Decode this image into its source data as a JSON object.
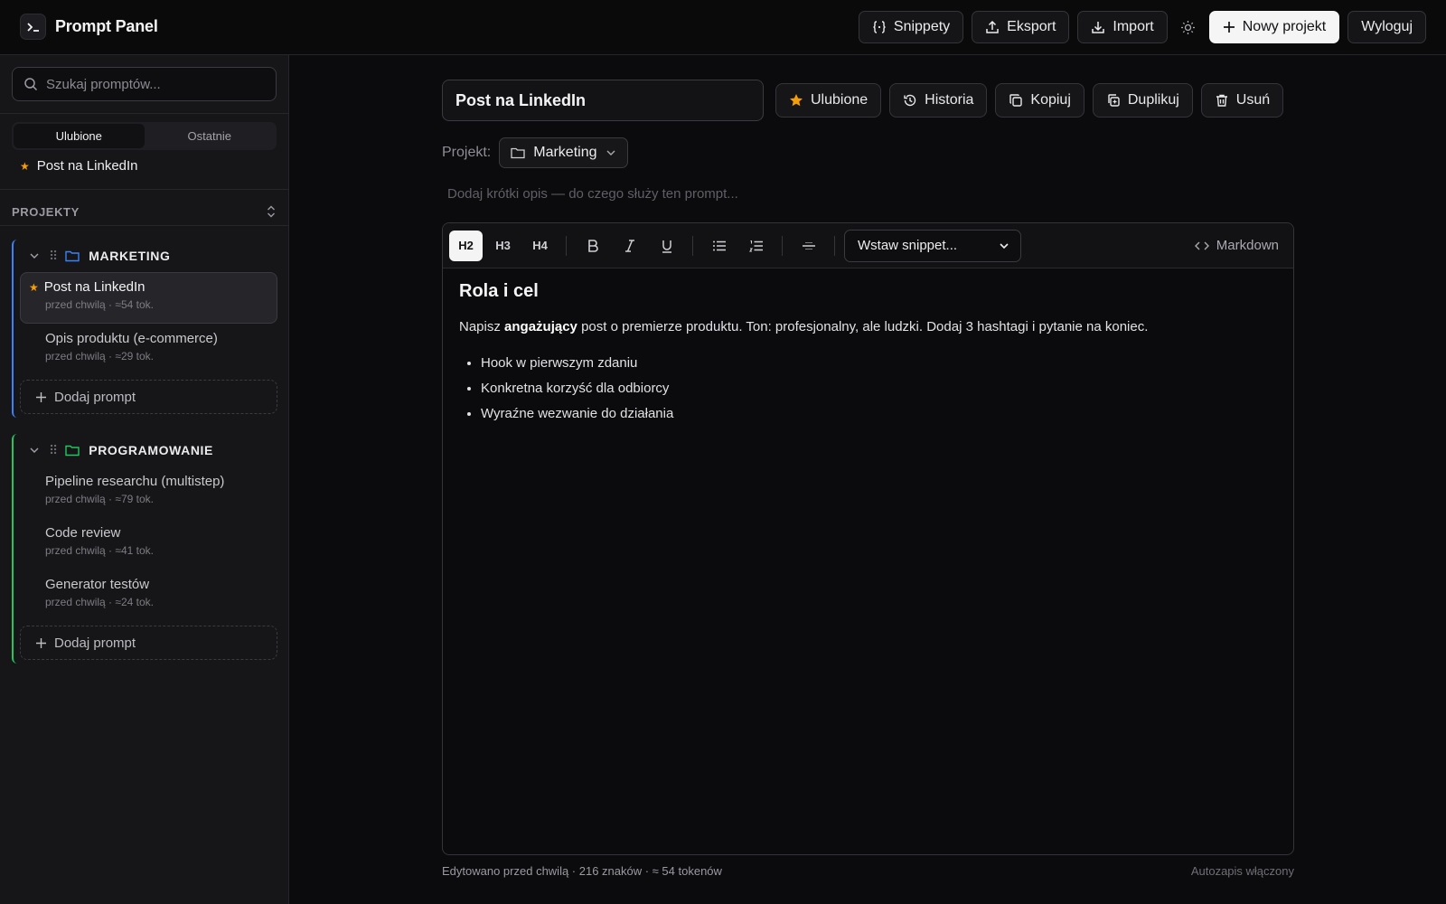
{
  "app": {
    "title": "Prompt Panel"
  },
  "topbar": {
    "snippets": "Snippety",
    "export": "Eksport",
    "import": "Import",
    "new_project": "Nowy projekt",
    "logout": "Wyloguj"
  },
  "sidebar": {
    "search_placeholder": "Szukaj promptów...",
    "tabs": [
      {
        "label": "Ulubione",
        "active": true
      },
      {
        "label": "Ostatnie",
        "active": false
      }
    ],
    "favorites": [
      {
        "label": "Post na LinkedIn"
      }
    ],
    "projects_header": "PROJEKTY",
    "groups": [
      {
        "name": "MARKETING",
        "color": "#3b82f6",
        "items": [
          {
            "name": "Post na LinkedIn",
            "meta": "przed chwilą · ≈54 tok.",
            "starred": true,
            "active": true
          },
          {
            "name": "Opis produktu (e-commerce)",
            "meta": "przed chwilą · ≈29 tok."
          }
        ],
        "add_label": "Dodaj prompt"
      },
      {
        "name": "PROGRAMOWANIE",
        "color": "#22c55e",
        "items": [
          {
            "name": "Pipeline researchu (multistep)",
            "meta": "przed chwilą · ≈79 tok."
          },
          {
            "name": "Code review",
            "meta": "przed chwilą · ≈41 tok."
          },
          {
            "name": "Generator testów",
            "meta": "przed chwilą · ≈24 tok."
          }
        ],
        "add_label": "Dodaj prompt"
      }
    ]
  },
  "editor_header": {
    "title_value": "Post na LinkedIn",
    "actions": {
      "favorite": "Ulubione",
      "history": "Historia",
      "copy": "Kopiuj",
      "duplicate": "Duplikuj",
      "delete": "Usuń"
    },
    "project_label": "Projekt:",
    "project_value": "Marketing",
    "description_placeholder": "Dodaj krótki opis — do czego służy ten prompt..."
  },
  "toolbar": {
    "h2": "H2",
    "h3": "H3",
    "h4": "H4",
    "snippet_select": "Wstaw snippet...",
    "markdown": "Markdown"
  },
  "document": {
    "heading": "Rola i cel",
    "para_before": "Napisz ",
    "para_bold": "angażujący",
    "para_after": " post o premierze produktu. Ton: profesjonalny, ale ludzki. Dodaj 3 hashtagi i pytanie na koniec.",
    "bullets": [
      "Hook w pierwszym zdaniu",
      "Konkretna korzyść dla odbiorcy",
      "Wyraźne wezwanie do działania"
    ]
  },
  "footer": {
    "status": "Edytowano przed chwilą · 216 znaków · ≈ 54 tokenów",
    "autosave": "Autozapis włączony"
  },
  "colors": {
    "favorite_star": "#f59e0b",
    "marketing": "#3b82f6",
    "programowanie": "#22c55e"
  }
}
